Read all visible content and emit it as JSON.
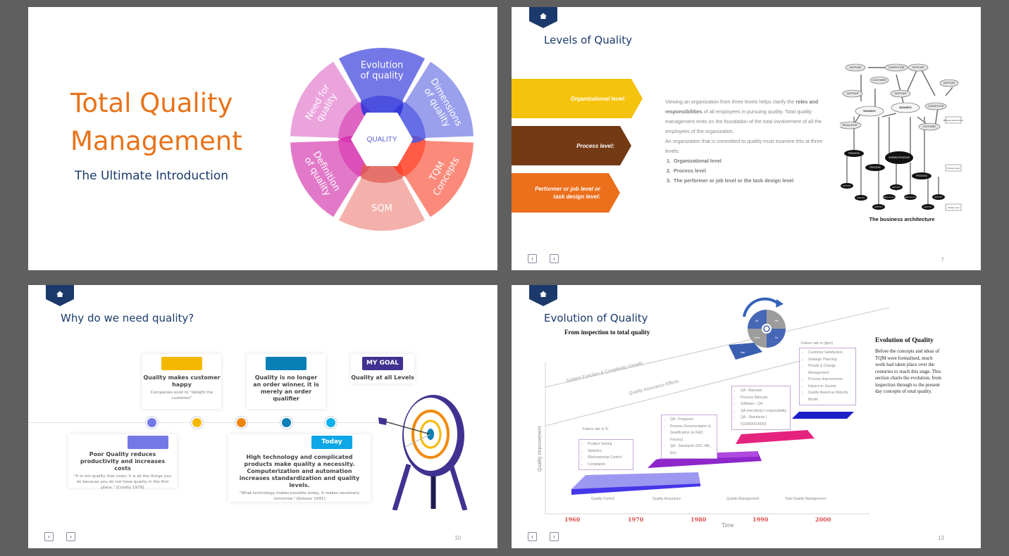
{
  "slides": [
    {
      "title_line1": "Total Quality",
      "title_line2": "Management",
      "subtitle": "The Ultimate Introduction",
      "wheel": {
        "center_label": "QUALITY",
        "segments": [
          {
            "label_line1": "Evolution",
            "label_line2": "of quality",
            "color": "#7478e6"
          },
          {
            "label_line1": "Dimensions",
            "label_line2": "of quality",
            "color": "#9aa0ec"
          },
          {
            "label_line1": "TQM",
            "label_line2": "Concepts",
            "color": "#fb8a7b"
          },
          {
            "label_line1": "SQM",
            "label_line2": "",
            "color": "#f4b1ab"
          },
          {
            "label_line1": "Definition",
            "label_line2": "of quality",
            "color": "#e279c8"
          },
          {
            "label_line1": "Need for",
            "label_line2": "quality",
            "color": "#eba3dc"
          }
        ]
      }
    },
    {
      "title": "Levels of Quality",
      "levels": [
        {
          "label": "Organizational level:",
          "color": "#f5c20c"
        },
        {
          "label": "Process level:",
          "color": "#733a14"
        },
        {
          "label": "Performer or job level or task design level:",
          "color": "#ec6f1c"
        }
      ],
      "paragraph": {
        "p1_a": "Viewing an organization from three levels helps clarify the ",
        "p1_b": "roles and responsibilities",
        "p1_c": " of all  employees in pursuing quality. Total quality management rests on the foundation of the  total involvement of all the employees of the organization.",
        "p2": "An organization that is committed to quality must examine this at three levels:",
        "list": [
          "Organizational level",
          "Process level",
          "The performer or job level or the task design level"
        ]
      },
      "figure": {
        "caption": "The business architecture",
        "nodes": {
          "supplier": "SUPPLIER",
          "competitor": "COMPETITOR",
          "customer": "CUSTOMER",
          "business": "BUSINESS",
          "regulator": "REGULATOR",
          "process": "PROCESS",
          "shared_process": "SHARED PROCESS",
          "activity": "ACTIVITY",
          "shared_activity": "SHARED ACTIVITY"
        },
        "legend": [
          "Business Environment",
          "Process Level",
          "Activity Level"
        ]
      },
      "page": "7"
    },
    {
      "title": "Why do we need quality?",
      "cards": [
        {
          "badge": "",
          "badge_color": "#f5b800",
          "heading": "Quality makes customer happy",
          "sub": "Companies exist to \"delight the customer\""
        },
        {
          "badge": "",
          "badge_color": "#0a7fb5",
          "heading": "Quality is no longer an order winner, it is merely an order qualifier",
          "sub": ""
        },
        {
          "badge": "MY GOAL",
          "badge_color": "#3f3290",
          "heading": "Quality at all Levels",
          "sub": ""
        },
        {
          "badge": "",
          "badge_color": "#7478e6",
          "heading": "Poor Quality reduces productivity and increases costs",
          "sub": "\"It is not quality that costs, it is all the things you do because you do not have quality in the first place.\" [Crosby 1979]"
        },
        {
          "badge": "Today",
          "badge_color": "#0ea7e6",
          "heading": "High technology and complicated products make quality a necessity. Computerization and automation increases standardization and quality levels.",
          "sub": "\"What technology makes possible today, it makes necessary tomorrow.\" [Kolesar 1991]"
        }
      ],
      "timeline_colors": [
        "#7478e6",
        "#f5b800",
        "#ef8510",
        "#0a7fb5",
        "#0eb0ea"
      ],
      "page": "10"
    },
    {
      "title": "Evolution of Quality",
      "subtitle": "From inspection to total quality",
      "diagonal_labels": [
        "System Function & Complexity Growth",
        "Quality Assurance Efforts"
      ],
      "y_axis_label": "Quality Improvement",
      "x_axis_label": "Time",
      "years": [
        "1960",
        "1970",
        "1980",
        "1990",
        "2000"
      ],
      "eras": [
        "Quality Control",
        "Quality Assurance",
        "Quality Management",
        "Total Quality Management"
      ],
      "boxes": [
        {
          "caption": "Failure rate in %",
          "items": [
            "Product Testing",
            "Statistics",
            "Workmanship Control",
            "Complaints"
          ]
        },
        {
          "caption": "",
          "items": [
            "QA - Programs",
            "Process Documentation & Qualification (in R&D, Factory)",
            "QA - Standards (ISO, MIL, Etc)"
          ]
        },
        {
          "caption": "",
          "items": [
            "QA - Manuals",
            "Process Manuals",
            "Software - QA",
            "QA everybody's responsibility",
            "QA - Standards ( ISO9000/14000)"
          ]
        },
        {
          "caption": "Failure rate in (dpm)",
          "items": [
            "Customer Satisfaction",
            "Strategic Planning",
            "People & Change Management",
            "Process Improvement",
            "Impact on Society",
            "Quality Award as Maturity Model"
          ]
        }
      ],
      "pdca": [
        "Act",
        "Plan",
        "Check",
        "Do"
      ],
      "start_label": "Start",
      "side": {
        "heading": "Evolution of Quality",
        "body": "Before the concepts  and ideas of TQM were formalised, much work had taken place over the centuries to reach this stage. This section charts the evolution, from  inspection through  to the present day concepts of total quality."
      },
      "page": "13"
    }
  ],
  "nav": {
    "prev": "‹",
    "next": "›"
  },
  "colors": {
    "navy": "#1b3a6b",
    "orange": "#e8731a",
    "year_red": "#d9534f"
  }
}
